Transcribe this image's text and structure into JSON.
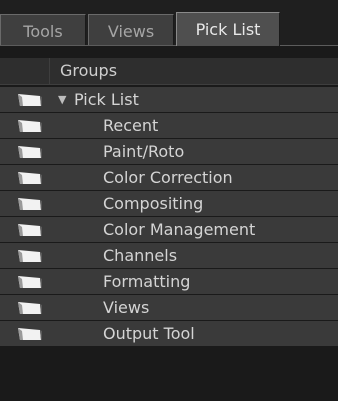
{
  "tabs": [
    {
      "label": "Tools",
      "active": false
    },
    {
      "label": "Views",
      "active": false
    },
    {
      "label": "Pick List",
      "active": true
    }
  ],
  "header": {
    "groups_label": "Groups"
  },
  "tree": {
    "root": {
      "label": "Pick List",
      "expanded": true,
      "arrow": "▼"
    },
    "children": [
      "Recent",
      "Paint/Roto",
      "Color Correction",
      "Compositing",
      "Color Management",
      "Channels",
      "Formatting",
      "Views",
      "Output Tool"
    ]
  },
  "icons": {
    "folder": "folder-icon"
  },
  "colors": {
    "panel_bg": "#1a1a1a",
    "row_bg": "#3a3a3a",
    "tab_active": "#4f4f4f",
    "tab_inactive": "#3f3f3f"
  }
}
